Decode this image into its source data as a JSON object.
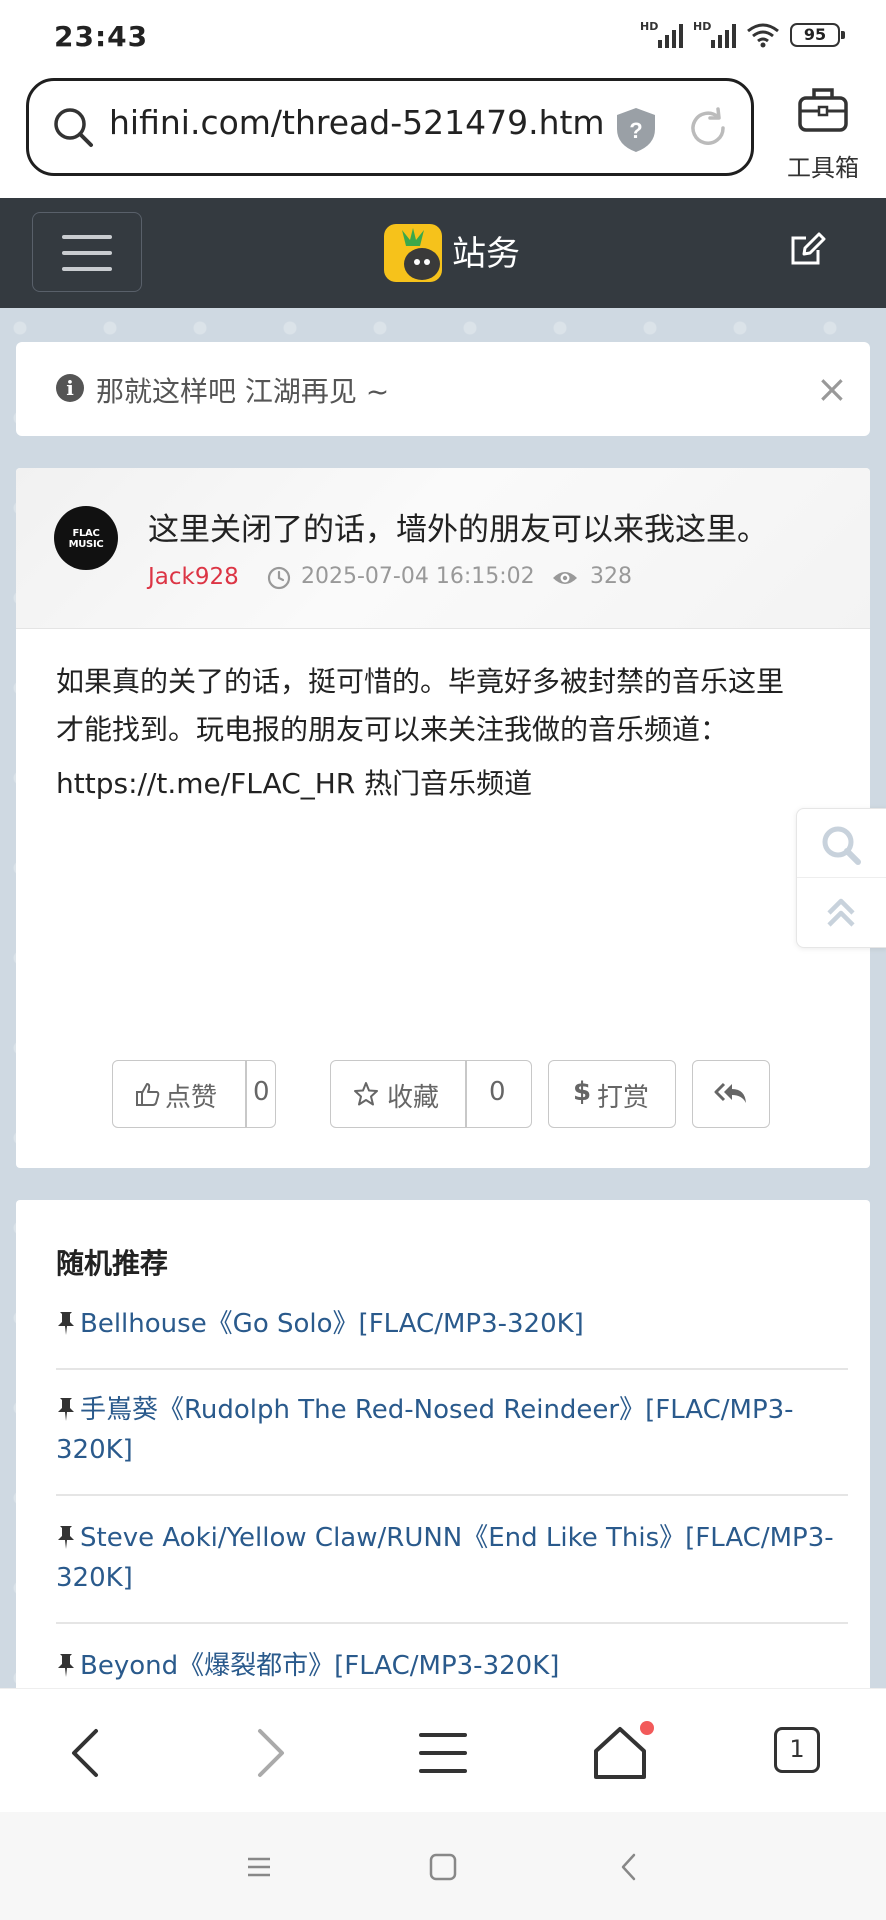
{
  "status_bar": {
    "time": "23:43",
    "signal_labels": [
      "HD",
      "HD"
    ],
    "battery": "95"
  },
  "browser": {
    "url": "hifini.com/thread-521479.htm",
    "toolbox_label": "工具箱",
    "tab_count": "1"
  },
  "site": {
    "name": "站务"
  },
  "notice": {
    "text": "那就这样吧 江湖再见 ~",
    "close": "×"
  },
  "post": {
    "title": "这里关闭了的话，墙外的朋友可以来我这里。",
    "author": "Jack928",
    "date": "2025-07-04 16:15:02",
    "views": "328",
    "avatar_text": "FLAC MUSIC",
    "body_line1": "如果真的关了的话，挺可惜的。毕竟好多被封禁的音乐这里",
    "body_line2": "才能找到。玩电报的朋友可以来关注我做的音乐频道：",
    "body_link": "https://t.me/FLAC_HR 热门音乐频道"
  },
  "actions": {
    "like_label": "点赞",
    "like_count": "0",
    "fav_label": "收藏",
    "fav_count": "0",
    "tip_label": "打赏"
  },
  "recommend": {
    "title": "随机推荐",
    "items": [
      {
        "line1": "Bellhouse《Go Solo》[FLAC/MP3-320K]",
        "line2": ""
      },
      {
        "line1": "手嶌葵《Rudolph The Red-Nosed Reindeer》[FLAC/MP3-",
        "line2": "320K]"
      },
      {
        "line1": "Steve Aoki/Yellow Claw/RUNN《End Like This》[FLAC/MP3-",
        "line2": "320K]"
      },
      {
        "line1": "Beyond《爆裂都市》[FLAC/MP3-320K]",
        "line2": ""
      }
    ]
  },
  "colors": {
    "header_bg": "#343a40",
    "author": "#dc3545",
    "link": "#2a5a8c",
    "page_bg": "#cfd9e2"
  }
}
